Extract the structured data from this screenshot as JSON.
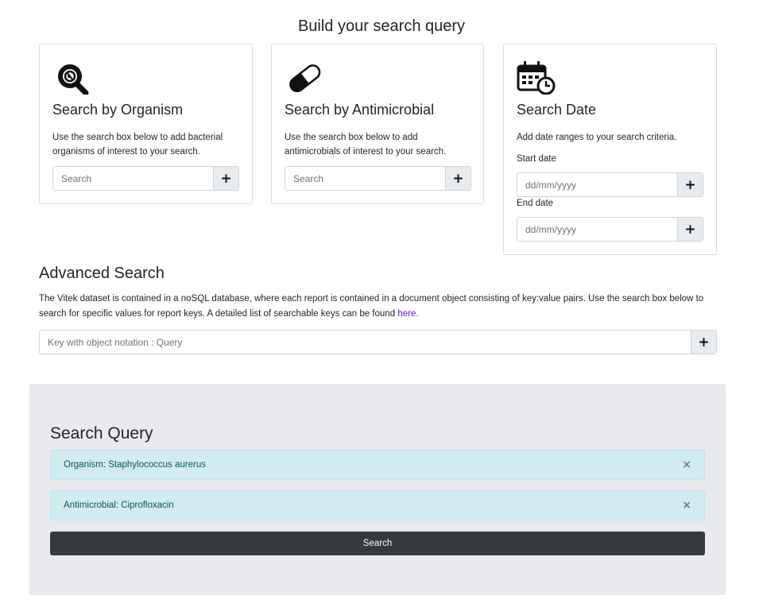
{
  "page": {
    "title": "Build your search query"
  },
  "organism_card": {
    "title": "Search by Organism",
    "description": "Use the search box below to add bacterial organisms of interest to your search.",
    "input_placeholder": "Search",
    "add_label": "+",
    "icon": "organism-search-icon"
  },
  "antimicrobial_card": {
    "title": "Search by Antimicrobial",
    "description": "Use the search box below to add antimicrobials of interest to your search.",
    "input_placeholder": "Search",
    "add_label": "+",
    "icon": "pill-icon"
  },
  "date_card": {
    "title": "Search Date",
    "description": "Add date ranges to your search criteria.",
    "start_label": "Start date",
    "start_placeholder": "dd/mm/yyyy",
    "end_label": "End date",
    "end_placeholder": "dd/mm/yyyy",
    "add_label": "+",
    "icon": "calendar-clock-icon"
  },
  "advanced": {
    "title": "Advanced Search",
    "description": "The Vitek dataset is contained in a noSQL database, where each report is contained in a document object consisting of key:value pairs. Use the search box below to search for specific values for report keys. A detailed list of searchable keys can be found",
    "link_text": "here.",
    "input_placeholder": "Key with object notation : Query",
    "add_label": "+"
  },
  "query": {
    "title": "Search Query",
    "filters": [
      {
        "text": "Organism: Staphylococcus aurerus",
        "close": "×"
      },
      {
        "text": "Antimicrobial: Ciprofloxacin",
        "close": "×"
      }
    ],
    "search_label": "Search"
  },
  "colors": {
    "alert_bg": "#d1ecf1",
    "alert_text": "#0c5460",
    "search_button": "#343a40",
    "panel_bg": "#e9eaee",
    "link": "#6610f2"
  }
}
